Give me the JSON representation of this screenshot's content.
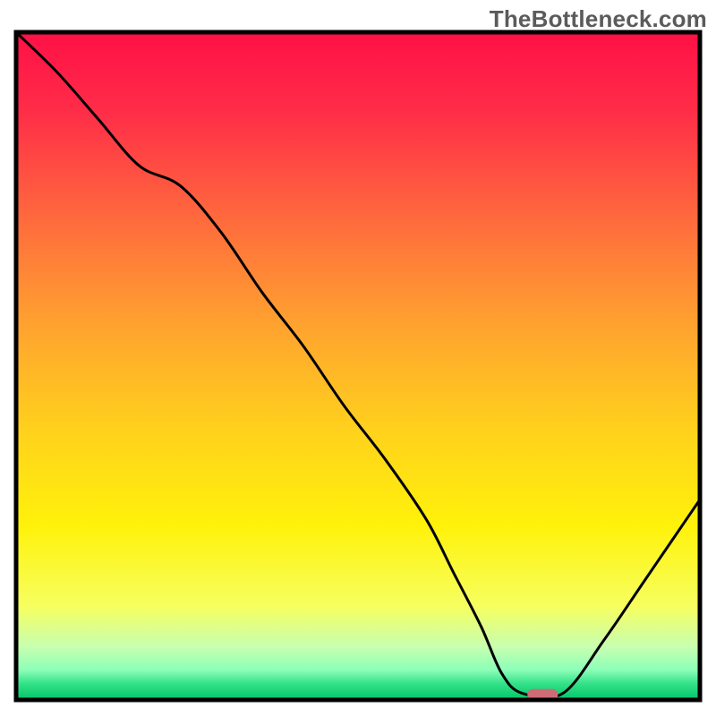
{
  "watermark": "TheBottleneck.com",
  "chart_data": {
    "type": "line",
    "title": "",
    "xlabel": "",
    "ylabel": "",
    "xlim": [
      0,
      100
    ],
    "ylim": [
      0,
      100
    ],
    "note": "Axes are unlabeled; values are normalized estimates (0 = bottom/left, 100 = top/right).",
    "series": [
      {
        "name": "bottleneck-curve",
        "x": [
          0,
          6,
          12,
          18,
          24,
          30,
          36,
          42,
          48,
          54,
          60,
          64,
          68,
          71,
          74,
          80,
          86,
          92,
          100
        ],
        "y": [
          100,
          94,
          87,
          80,
          77,
          70,
          61,
          53,
          44,
          36,
          27,
          19,
          11,
          4,
          1,
          1,
          9,
          18,
          30
        ]
      }
    ],
    "markers": [
      {
        "name": "optimal-point",
        "x": 77,
        "y": 0.7,
        "color": "#cf6b74",
        "shape": "pill"
      }
    ],
    "background_gradient": {
      "type": "vertical",
      "stops": [
        {
          "pos": 0.0,
          "color": "#ff1046"
        },
        {
          "pos": 0.12,
          "color": "#ff2d48"
        },
        {
          "pos": 0.28,
          "color": "#ff6a3d"
        },
        {
          "pos": 0.44,
          "color": "#ffa32f"
        },
        {
          "pos": 0.6,
          "color": "#ffd21c"
        },
        {
          "pos": 0.74,
          "color": "#fff20a"
        },
        {
          "pos": 0.86,
          "color": "#f6ff60"
        },
        {
          "pos": 0.92,
          "color": "#c8ffb0"
        },
        {
          "pos": 0.955,
          "color": "#8dffb8"
        },
        {
          "pos": 0.975,
          "color": "#35e28a"
        },
        {
          "pos": 1.0,
          "color": "#00c567"
        }
      ]
    },
    "frame": {
      "stroke": "#000000",
      "stroke_width": 5
    }
  }
}
